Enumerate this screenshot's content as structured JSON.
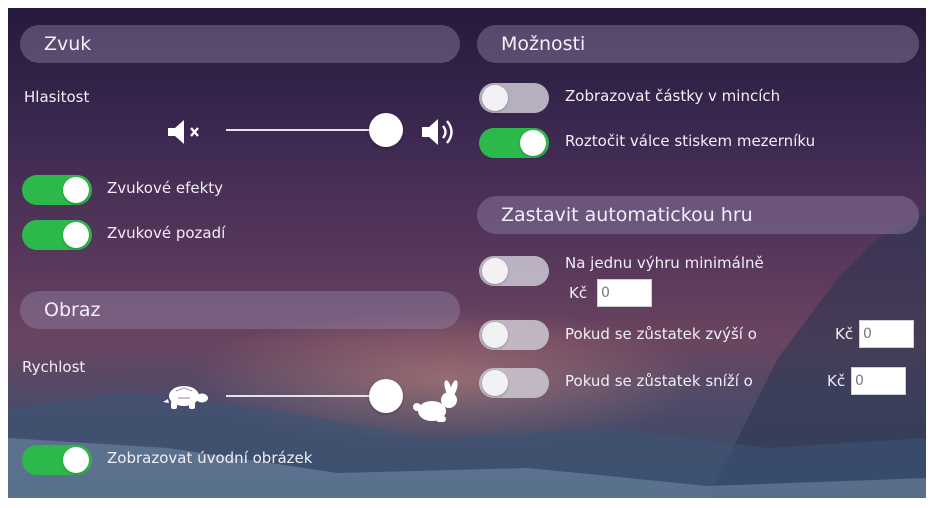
{
  "sound": {
    "header": "Zvuk",
    "volume_label": "Hlasitost",
    "volume_level_percent": 100,
    "effects": {
      "label": "Zvukové efekty",
      "on": true
    },
    "background": {
      "label": "Zvukové pozadí",
      "on": true
    }
  },
  "picture": {
    "header": "Obraz",
    "speed_label": "Rychlost",
    "speed_level_percent": 100,
    "intro": {
      "label": "Zobrazovat úvodní obrázek",
      "on": true
    }
  },
  "options": {
    "header": "Možnosti",
    "coins": {
      "label": "Zobrazovat částky v mincích",
      "on": false
    },
    "spacebar": {
      "label": "Roztočit válce stiskem mezerníku",
      "on": true
    }
  },
  "autoplay_stop": {
    "header": "Zastavit automatickou hru",
    "single_win": {
      "label": "Na jednu výhru minimálně",
      "currency": "Kč",
      "value": "0",
      "on": false
    },
    "balance_up": {
      "label": "Pokud se zůstatek zvýší o",
      "currency": "Kč",
      "value": "0",
      "on": false
    },
    "balance_down": {
      "label": "Pokud se zůstatek sníží o",
      "currency": "Kč",
      "value": "0",
      "on": false
    }
  },
  "icons": {
    "mute": "speaker-mute-icon",
    "volume": "speaker-loud-icon",
    "slow": "turtle-icon",
    "fast": "rabbit-icon"
  },
  "colors": {
    "toggle_on": "#2db84b",
    "toggle_off": "#cdc8d4",
    "header_bg": "#968faf"
  }
}
